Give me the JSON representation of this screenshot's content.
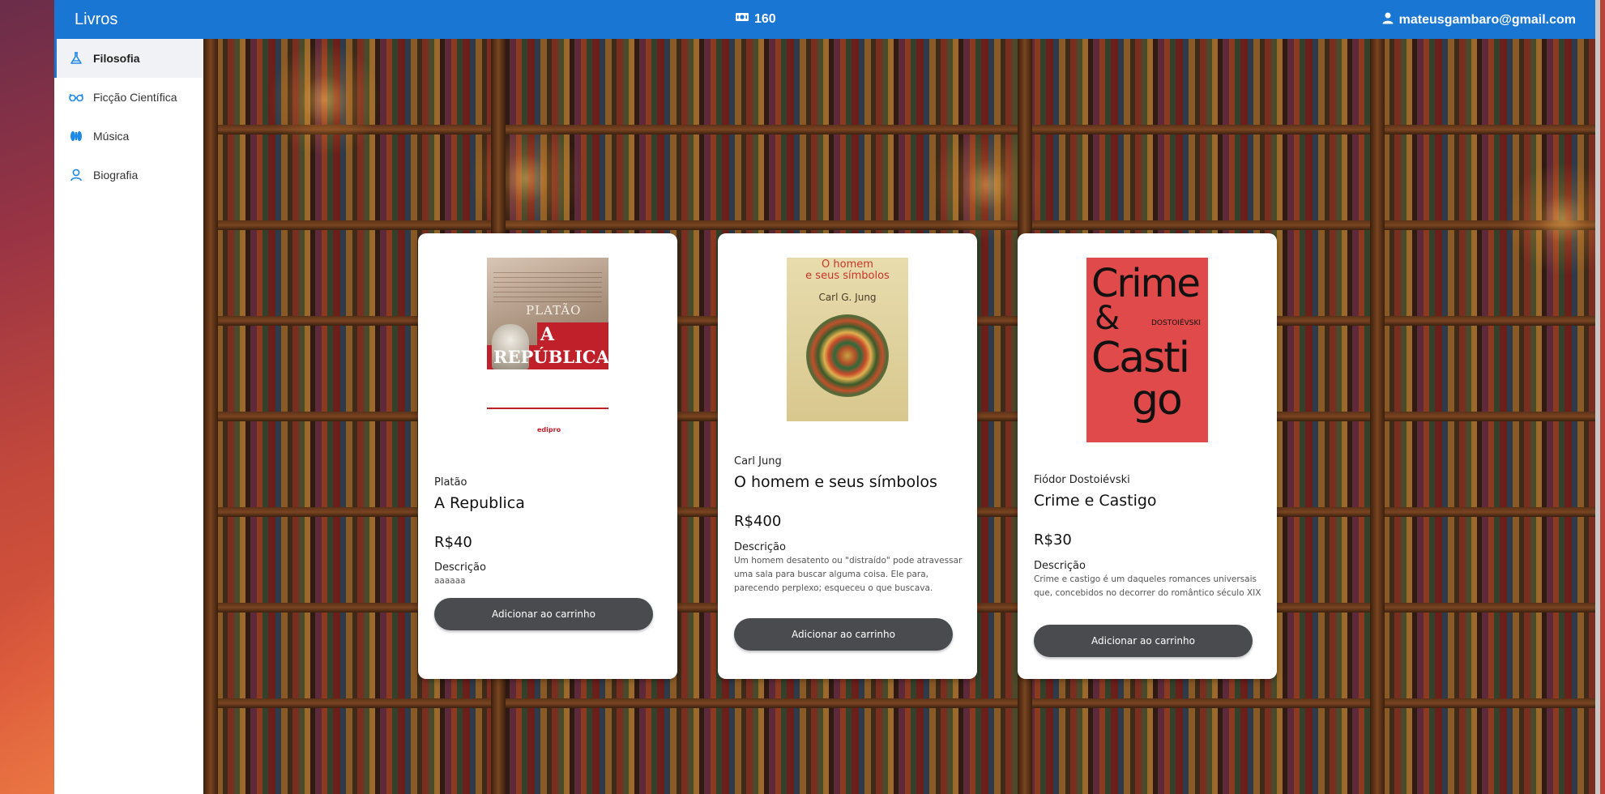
{
  "header": {
    "brand": "Livros",
    "credits": "160",
    "user_email": "mateusgambaro@gmail.com"
  },
  "sidebar": {
    "items": [
      {
        "label": "Filosofia",
        "icon": "flask-icon",
        "active": true
      },
      {
        "label": "Ficção Científica",
        "icon": "glasses-icon",
        "active": false
      },
      {
        "label": "Música",
        "icon": "headphones-icon",
        "active": false
      },
      {
        "label": "Biografia",
        "icon": "person-icon",
        "active": false
      }
    ]
  },
  "products": [
    {
      "author": "Platão",
      "title": "A Republica",
      "price": "R$40",
      "description_label": "Descrição",
      "description": "aaaaaa",
      "button": "Adicionar ao carrinho",
      "cover": {
        "author": "PLATÃO",
        "title_line1": "A",
        "title_line2": "REPÚBLICA",
        "publisher": "edipro"
      }
    },
    {
      "author": "Carl Jung",
      "title": "O homem e seus símbolos",
      "price": "R$400",
      "description_label": "Descrição",
      "description": "Um homem desatento ou \"distraído\" pode atravessar uma sala para buscar alguma coisa. Ele para, parecendo perplexo; esqueceu o que buscava.",
      "button": "Adicionar ao carrinho",
      "cover": {
        "title_line1": "O homem",
        "title_line2": "e seus símbolos",
        "author": "Carl G. Jung"
      }
    },
    {
      "author": "Fiódor Dostoiévski",
      "title": "Crime e Castigo",
      "price": "R$30",
      "description_label": "Descrição",
      "description": "Crime e castigo é um daqueles romances universais que, concebidos no decorrer do romântico século XIX",
      "button": "Adicionar ao carrinho",
      "cover": {
        "word1": "Crime",
        "word2": "&",
        "word3": "Casti",
        "word4": "go",
        "author": "DOSTOIÉVSKI"
      }
    }
  ],
  "colors": {
    "topbar": "#1976d2",
    "button": "#4a4b4f",
    "sidebar_active_bg": "#f0f2f5"
  }
}
